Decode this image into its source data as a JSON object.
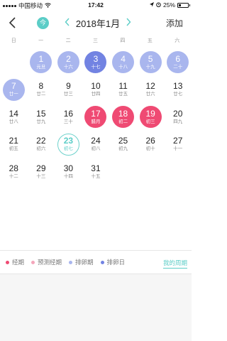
{
  "status_bar": {
    "carrier": "中国移动",
    "time": "17:42",
    "battery_percent": "25%"
  },
  "navbar": {
    "back_icon": "chevron-left-icon",
    "today_label": "今",
    "prev_icon": "chevron-left-icon",
    "month_title": "2018年1月",
    "next_icon": "chevron-right-icon",
    "add_label": "添加"
  },
  "weekdays": [
    "日",
    "一",
    "二",
    "三",
    "四",
    "五",
    "六"
  ],
  "colors": {
    "accent": "#5ccdc7",
    "period": "#ef4a73",
    "predicted_period": "#f4a6bb",
    "fertile": "#a9b6ee",
    "ovulation": "#7283e2"
  },
  "days": [
    {
      "empty": true
    },
    {
      "num": "1",
      "sub": "元旦",
      "type": "fertile"
    },
    {
      "num": "2",
      "sub": "十六",
      "type": "fertile"
    },
    {
      "num": "3",
      "sub": "十七",
      "type": "ovul"
    },
    {
      "num": "4",
      "sub": "十八",
      "type": "fertile"
    },
    {
      "num": "5",
      "sub": "十九",
      "type": "fertile"
    },
    {
      "num": "6",
      "sub": "二十",
      "type": "fertile"
    },
    {
      "num": "7",
      "sub": "廿一",
      "type": "fertile"
    },
    {
      "num": "8",
      "sub": "廿二",
      "type": ""
    },
    {
      "num": "9",
      "sub": "廿三",
      "type": ""
    },
    {
      "num": "10",
      "sub": "廿四",
      "type": ""
    },
    {
      "num": "11",
      "sub": "廿五",
      "type": ""
    },
    {
      "num": "12",
      "sub": "廿六",
      "type": ""
    },
    {
      "num": "13",
      "sub": "廿七",
      "type": ""
    },
    {
      "num": "14",
      "sub": "廿八",
      "type": ""
    },
    {
      "num": "15",
      "sub": "廿九",
      "type": ""
    },
    {
      "num": "16",
      "sub": "三十",
      "type": ""
    },
    {
      "num": "17",
      "sub": "腊月",
      "type": "period"
    },
    {
      "num": "18",
      "sub": "初二",
      "type": "period"
    },
    {
      "num": "19",
      "sub": "初三",
      "type": "period"
    },
    {
      "num": "20",
      "sub": "四九",
      "type": ""
    },
    {
      "num": "21",
      "sub": "初五",
      "type": ""
    },
    {
      "num": "22",
      "sub": "初六",
      "type": ""
    },
    {
      "num": "23",
      "sub": "初七",
      "type": "today"
    },
    {
      "num": "24",
      "sub": "初八",
      "type": ""
    },
    {
      "num": "25",
      "sub": "初九",
      "type": ""
    },
    {
      "num": "26",
      "sub": "初十",
      "type": ""
    },
    {
      "num": "27",
      "sub": "十一",
      "type": ""
    },
    {
      "num": "28",
      "sub": "十二",
      "type": ""
    },
    {
      "num": "29",
      "sub": "十三",
      "type": ""
    },
    {
      "num": "30",
      "sub": "十四",
      "type": ""
    },
    {
      "num": "31",
      "sub": "十五",
      "type": ""
    }
  ],
  "legend": {
    "items": [
      {
        "label": "经期",
        "color": "#ef4a73"
      },
      {
        "label": "预测经期",
        "color": "#f4a6bb"
      },
      {
        "label": "排卵期",
        "color": "#a9b6ee"
      },
      {
        "label": "排卵日",
        "color": "#7283e2"
      }
    ],
    "my_cycle": "我的周期"
  }
}
